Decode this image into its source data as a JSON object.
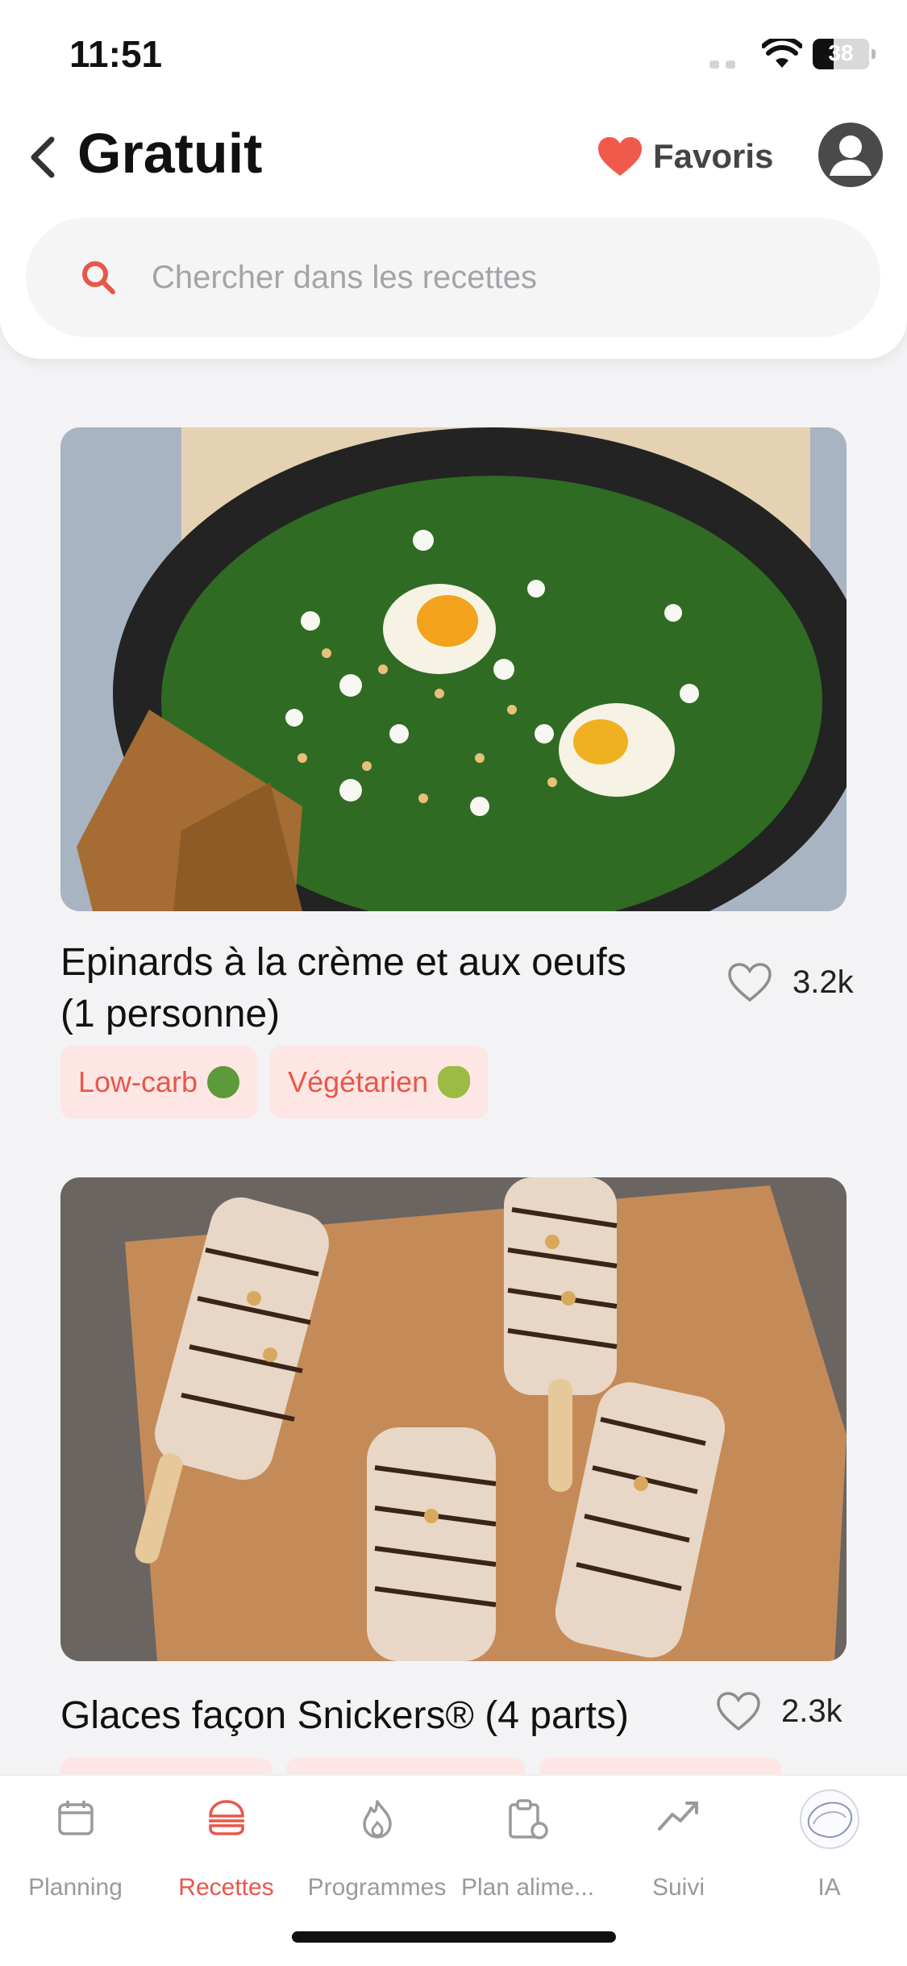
{
  "status_bar": {
    "time": "11:51",
    "battery": "38"
  },
  "header": {
    "title": "Gratuit",
    "favorites_label": "Favoris",
    "search_placeholder": "Chercher dans les recettes"
  },
  "recipes": [
    {
      "title_line1": "Epinards à la crème et aux oeufs",
      "title_line2": "(1 personne)",
      "likes": "3.2k",
      "tags": [
        {
          "label": "Low-carb",
          "emoji_icon": "salad-icon",
          "color": "#5c9a3a"
        },
        {
          "label": "Végétarien",
          "emoji_icon": "avocado-icon",
          "color": "#6b8e23"
        }
      ]
    },
    {
      "title_line1": "Glaces façon Snickers® (4 parts)",
      "likes": "2.3k"
    }
  ],
  "tabs": [
    {
      "label": "Planning",
      "icon": "calendar-icon"
    },
    {
      "label": "Recettes",
      "icon": "burger-icon",
      "active": true
    },
    {
      "label": "Programmes",
      "icon": "flame-icon"
    },
    {
      "label": "Plan alime...",
      "icon": "clipboard-icon"
    },
    {
      "label": "Suivi",
      "icon": "trend-icon"
    },
    {
      "label": "IA",
      "icon": "ai-orb-icon"
    }
  ],
  "colors": {
    "accent": "#e8574a",
    "heart": "#f05a4a",
    "tag_bg": "#fde6e4"
  }
}
